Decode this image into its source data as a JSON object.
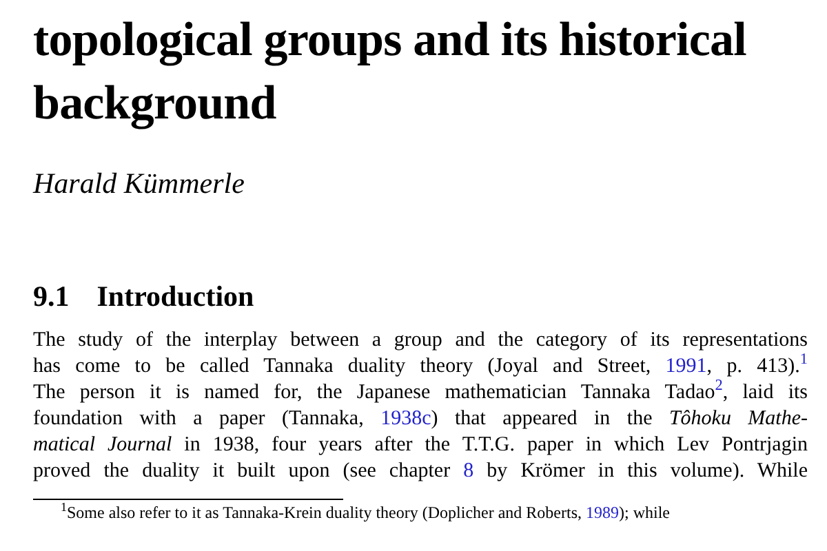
{
  "title_lines": [
    "topological groups and its historical",
    "background"
  ],
  "author": "Harald Kümmerle",
  "section": {
    "number": "9.1",
    "title": "Introduction"
  },
  "paragraph_lines": [
    [
      {
        "kind": "text",
        "text": "The study of the interplay between a group and the category of its representations"
      }
    ],
    [
      {
        "kind": "text",
        "text": "has come to be called Tannaka duality theory (Joyal and Street, "
      },
      {
        "kind": "link",
        "text": "1991"
      },
      {
        "kind": "text",
        "text": ", p. 413)."
      },
      {
        "kind": "link",
        "text": "$^{1}$"
      }
    ],
    [
      {
        "kind": "text",
        "text": "The person it is named for, the Japanese mathematician Tannaka Tadao"
      },
      {
        "kind": "link",
        "text": "$^{2}$"
      },
      {
        "kind": "text",
        "text": ", laid its"
      }
    ],
    [
      {
        "kind": "text",
        "text": "foundation with a paper (Tannaka, "
      },
      {
        "kind": "link",
        "text": "1938c"
      },
      {
        "kind": "text",
        "text": ") that appeared in the *Tôhoku Mathe-*"
      }
    ],
    [
      {
        "kind": "text",
        "text": "*matical Journal* in 1938, four years after the T.T.G. paper in which Lev Pontrjagin"
      }
    ],
    [
      {
        "kind": "text",
        "text": "proved the duality it built upon (see chapter "
      },
      {
        "kind": "link",
        "text": "8"
      },
      {
        "kind": "text",
        "text": " by Krömer in this volume). While"
      }
    ]
  ],
  "footnote": [
    {
      "kind": "text",
      "text": "$^{1}$Some also refer to it as Tannaka-Krein duality theory (Doplicher and Roberts, "
    },
    {
      "kind": "link",
      "text": "1989"
    },
    {
      "kind": "text",
      "text": "); while"
    }
  ]
}
